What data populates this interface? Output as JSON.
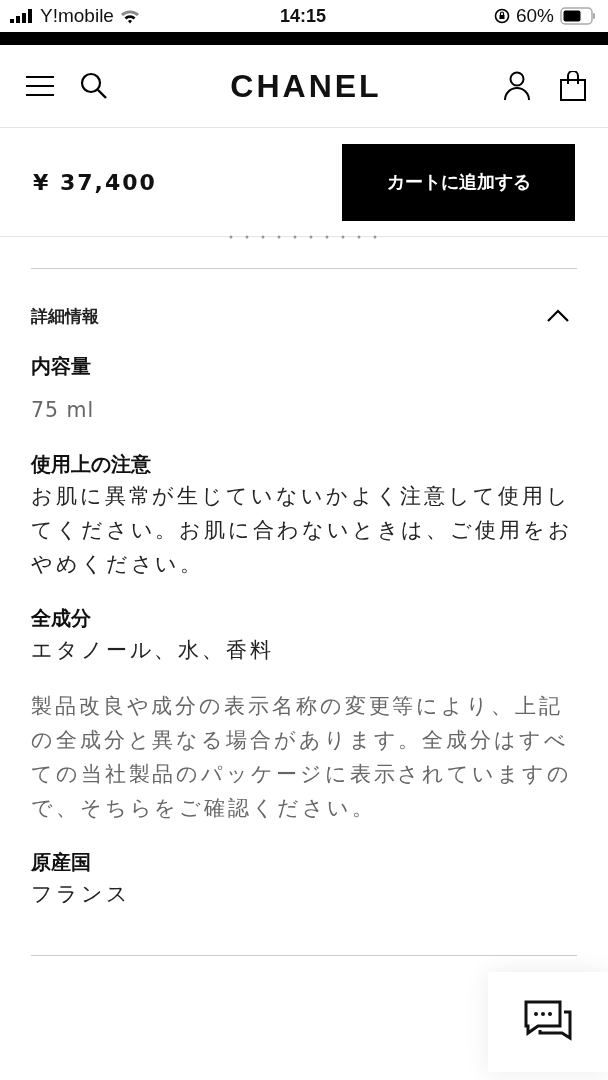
{
  "status_bar": {
    "carrier": "Y!mobile",
    "time": "14:15",
    "battery": "60%"
  },
  "header": {
    "logo": "CHANEL"
  },
  "purchase_bar": {
    "price": "¥ 37,400",
    "button": "カートに追加する"
  },
  "details": {
    "title": "詳細情報",
    "expanded": true,
    "sections": [
      {
        "heading": "内容量",
        "body": "75 ml",
        "muted": true
      },
      {
        "heading": "使用上の注意",
        "body": "お肌に異常が生じていないかよく注意して使用してください。お肌に合わないときは、ご使用をおやめください。",
        "muted": false
      },
      {
        "heading": "全成分",
        "body": "エタノール、水、香料",
        "muted": false
      },
      {
        "body": "製品改良や成分の表示名称の変更等により、上記の全成分と異なる場合があります。全成分はすべての当社製品のパッケージに表示されていますので、そちらをご確認ください。",
        "muted": true
      },
      {
        "heading": "原産国",
        "body": "フランス",
        "muted": false
      }
    ]
  }
}
